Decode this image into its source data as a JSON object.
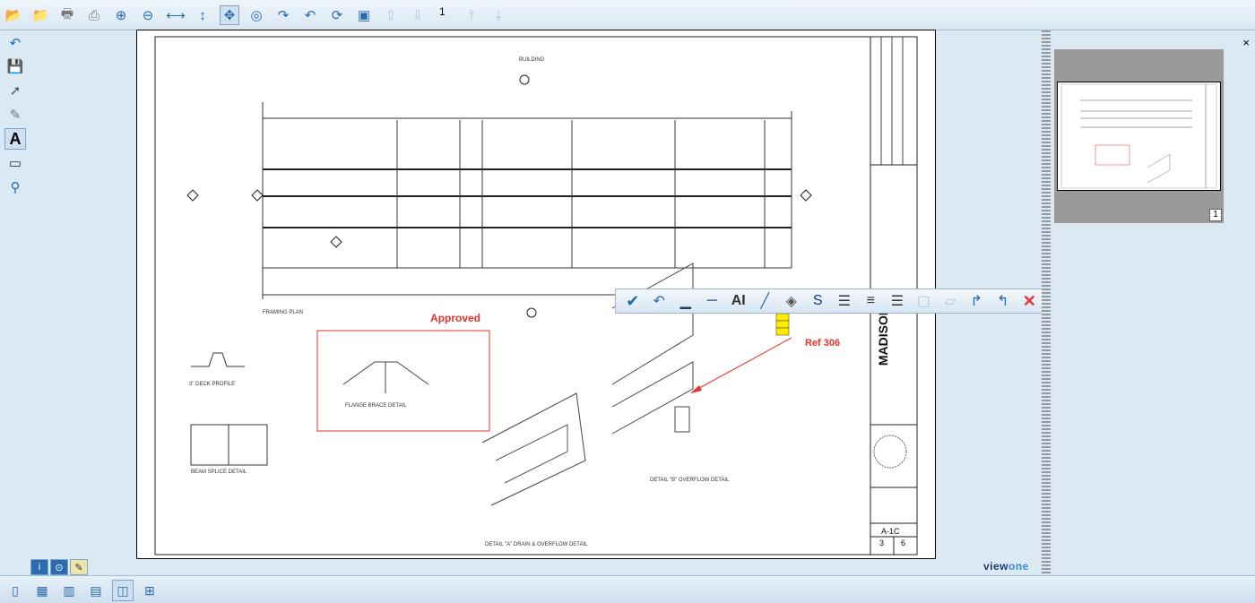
{
  "top_toolbar": {
    "icons": [
      "open-folder-icon",
      "close-document-icon",
      "print-icon",
      "print-preview-icon",
      "zoom-in-icon",
      "zoom-out-icon",
      "fit-width-icon",
      "fit-height-icon",
      "pan-icon",
      "magnifier-icon",
      "rotate-clockwise-icon",
      "rotate-counterclockwise-icon",
      "rotate-180-icon",
      "screenshot-icon",
      "previous-page-icon",
      "next-page-icon",
      "first-page-icon",
      "last-page-icon"
    ],
    "page_number": "1"
  },
  "left_toolbar": {
    "icons": [
      "undo-icon",
      "save-icon",
      "select-pointer-icon",
      "highlighter-icon",
      "text-annotation-icon",
      "rectangle-annotation-icon",
      "stamp-icon"
    ]
  },
  "document": {
    "annotation_approved": "Approved",
    "annotation_ref": "Ref 306",
    "drawing_labels": {
      "building": "BUILDING",
      "framing_plan": "FRAMING PLAN",
      "deck_profile": "3\" DECK PROFILE",
      "beam_splice": "BEAM SPLICE DETAIL",
      "flange_brace": "FLANGE BRACE DETAIL",
      "detail_b": "DETAIL \"B\" OVERFLOW DETAIL",
      "detail_a": "DETAIL \"A\" DRAIN & OVERFLOW DETAIL",
      "title_madison": "MADISON",
      "sheet_id": "A-1C",
      "sheet_num": "3",
      "sheet_total": "6"
    },
    "colors": {
      "annotation_red": "#e8322b",
      "stamp_yellow": "#ffeb00"
    }
  },
  "annotation_toolbar": {
    "icons": [
      "apply-check-icon",
      "undo-icon",
      "line-thickness-increase-icon",
      "line-thickness-decrease-icon",
      "font-size-icon",
      "line-color-icon",
      "fill-color-icon",
      "strikethrough-icon",
      "align-left-icon",
      "align-center-icon",
      "align-right-icon",
      "transparent-icon",
      "eraser-icon",
      "bring-forward-icon",
      "send-backward-icon",
      "delete-icon"
    ]
  },
  "thumbnails": {
    "close_glyph": "×",
    "page_badge": "1"
  },
  "panel_tabs": [
    "info-tab",
    "security-tab",
    "notes-tab"
  ],
  "logo": {
    "part1": "view",
    "part2": "one"
  },
  "bottom_toolbar": {
    "icons": [
      "single-page-icon",
      "grid-view-icon",
      "two-page-icon",
      "continuous-icon",
      "side-by-side-icon",
      "thumbnail-layout-icon"
    ]
  }
}
